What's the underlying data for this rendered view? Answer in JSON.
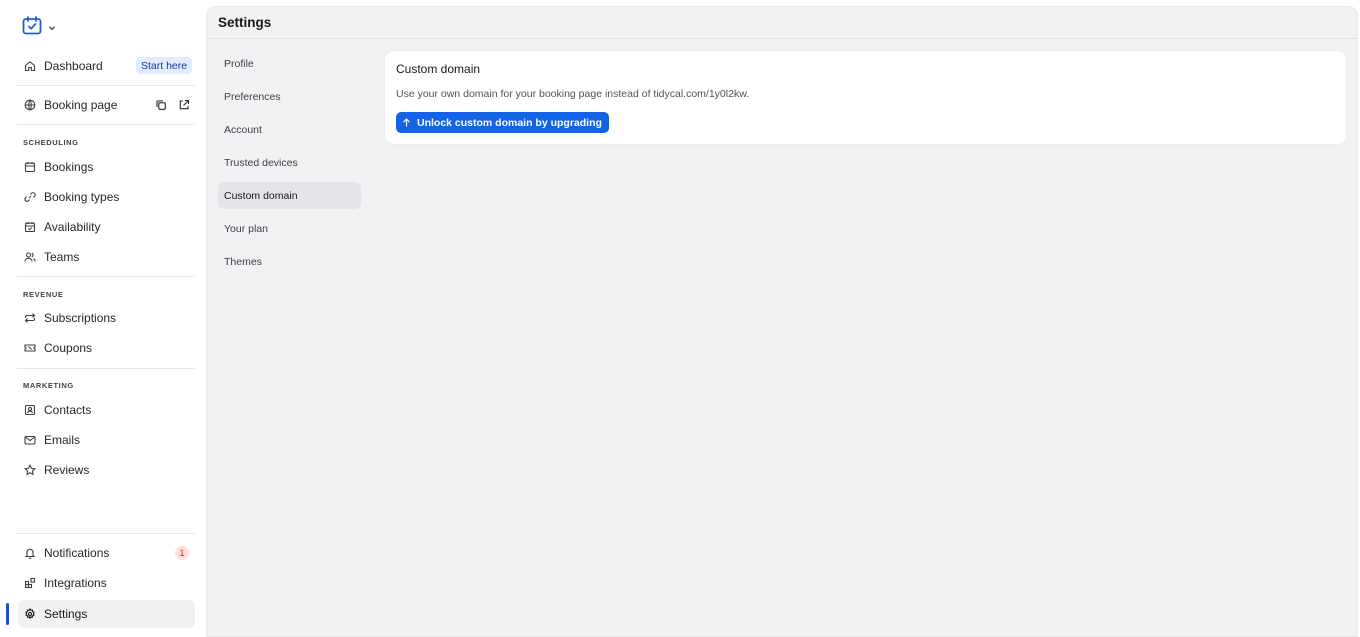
{
  "sidebar": {
    "items": {
      "dashboard": "Dashboard",
      "booking_page": "Booking page",
      "bookings": "Bookings",
      "booking_types": "Booking types",
      "availability": "Availability",
      "teams": "Teams",
      "subscriptions": "Subscriptions",
      "coupons": "Coupons",
      "contacts": "Contacts",
      "emails": "Emails",
      "reviews": "Reviews",
      "notifications": "Notifications",
      "integrations": "Integrations",
      "settings": "Settings"
    },
    "start_here": "Start here",
    "notifications_count": "1",
    "sections": {
      "scheduling": "SCHEDULING",
      "revenue": "REVENUE",
      "marketing": "MARKETING"
    },
    "active_item": "settings",
    "accent_color": "#1d4ed8"
  },
  "header": {
    "title": "Settings"
  },
  "settings_nav": {
    "items": [
      "Profile",
      "Preferences",
      "Account",
      "Trusted devices",
      "Custom domain",
      "Your plan",
      "Themes"
    ],
    "active": "Custom domain"
  },
  "custom_domain_card": {
    "title": "Custom domain",
    "description": "Use your own domain for your booking page instead of tidycal.com/1y0l2kw.",
    "button_label": "Unlock custom domain by upgrading",
    "button_color": "#1463e6"
  }
}
